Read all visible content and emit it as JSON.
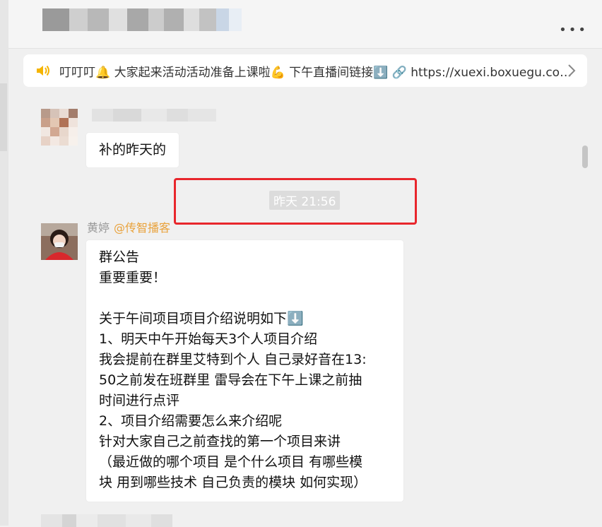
{
  "header": {
    "title_blurred": true,
    "more_label": "•••"
  },
  "notice": {
    "text": "叮叮叮🔔 大家起来活动活动准备上课啦💪 下午直播间链接⬇️ 🔗 https://xuexi.boxuegu.com..."
  },
  "messages": [
    {
      "type": "text",
      "sender_blurred": true,
      "text": "补的昨天的"
    },
    {
      "type": "time",
      "text": "昨天 21:56"
    },
    {
      "type": "text",
      "sender": "黄婷",
      "mention": "@传智播客",
      "lines": [
        "群公告",
        "重要重要！",
        "",
        "关于午间项目项目介绍说明如下⬇️",
        "1、明天中午开始每天3个人项目介绍",
        "我会提前在群里艾特到个人 自己录好音在13:",
        "50之前发在班群里 雷导会在下午上课之前抽",
        "时间进行点评",
        "2、项目介绍需要怎么来介绍呢",
        "针对大家自己之前查找的第一个项目来讲",
        "（最近做的哪个项目 是个什么项目 有哪些模",
        "块 用到哪些技术 自己负责的模块 如何实现）"
      ]
    }
  ],
  "colors": {
    "highlight_box": "#e8262c",
    "mention": "#e9a23b",
    "background": "#f0f0f0"
  },
  "icons": [
    "speaker-icon",
    "chevron-right-icon",
    "more-icon"
  ]
}
